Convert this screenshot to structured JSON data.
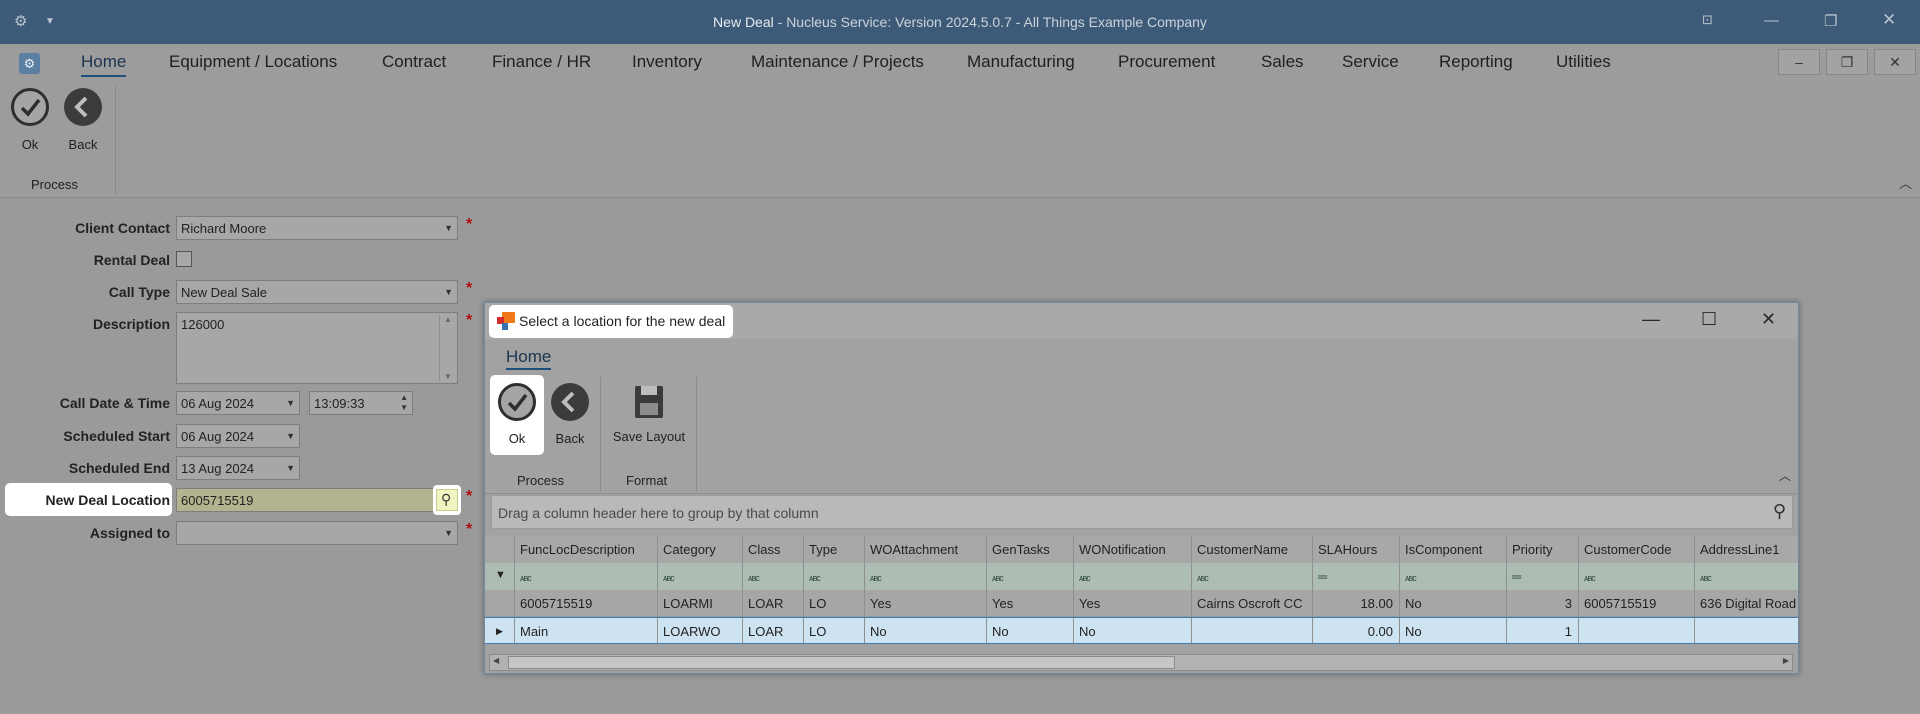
{
  "window": {
    "title_prefix": "New Deal",
    "title_suffix": " - Nucleus Service: Version 2024.5.0.7 - All Things Example Company"
  },
  "menu": {
    "items": [
      "Home",
      "Equipment / Locations",
      "Contract",
      "Finance / HR",
      "Inventory",
      "Maintenance / Projects",
      "Manufacturing",
      "Procurement",
      "Sales",
      "Service",
      "Reporting",
      "Utilities"
    ]
  },
  "ribbon": {
    "ok_label": "Ok",
    "back_label": "Back",
    "group_label": "Process"
  },
  "form": {
    "client_contact_label": "Client Contact",
    "client_contact_value": "Richard Moore",
    "rental_deal_label": "Rental Deal",
    "rental_deal_checked": false,
    "call_type_label": "Call Type",
    "call_type_value": "New Deal Sale",
    "description_label": "Description",
    "description_value": "126000",
    "call_datetime_label": "Call Date & Time",
    "call_date_value": "06 Aug 2024",
    "call_time_value": "13:09:33",
    "scheduled_start_label": "Scheduled Start",
    "scheduled_start_value": "06 Aug 2024",
    "scheduled_end_label": "Scheduled End",
    "scheduled_end_value": "13 Aug 2024",
    "new_deal_location_label": "New Deal Location",
    "new_deal_location_value": "6005715519",
    "assigned_to_label": "Assigned to",
    "assigned_to_value": "",
    "required_mark": "*"
  },
  "dialog": {
    "title": "Select a location for the new deal",
    "tab": "Home",
    "ok_label": "Ok",
    "back_label": "Back",
    "save_layout_label": "Save Layout",
    "process_group": "Process",
    "format_group": "Format",
    "group_by_hint": "Drag a column header here to group by that column",
    "columns": [
      "FuncLocDescription",
      "Category",
      "Class",
      "Type",
      "WOAttachment",
      "GenTasks",
      "WONotification",
      "CustomerName",
      "SLAHours",
      "IsComponent",
      "Priority",
      "CustomerCode",
      "AddressLine1"
    ],
    "rows": [
      [
        "6005715519",
        "LOARMI",
        "LOAR",
        "LO",
        "Yes",
        "Yes",
        "Yes",
        "Cairns Oscroft CC",
        "18.00",
        "No",
        "3",
        "6005715519",
        "636 Digital Road"
      ],
      [
        "Main",
        "LOARWO",
        "LOAR",
        "LO",
        "No",
        "No",
        "No",
        "",
        "0.00",
        "No",
        "1",
        "",
        ""
      ]
    ],
    "selected_row": 1
  },
  "colors": {
    "titlebar": "#3d5b78",
    "accent": "#1d4f7a",
    "required": "#b01010",
    "selected_row": "#cde3f2"
  }
}
